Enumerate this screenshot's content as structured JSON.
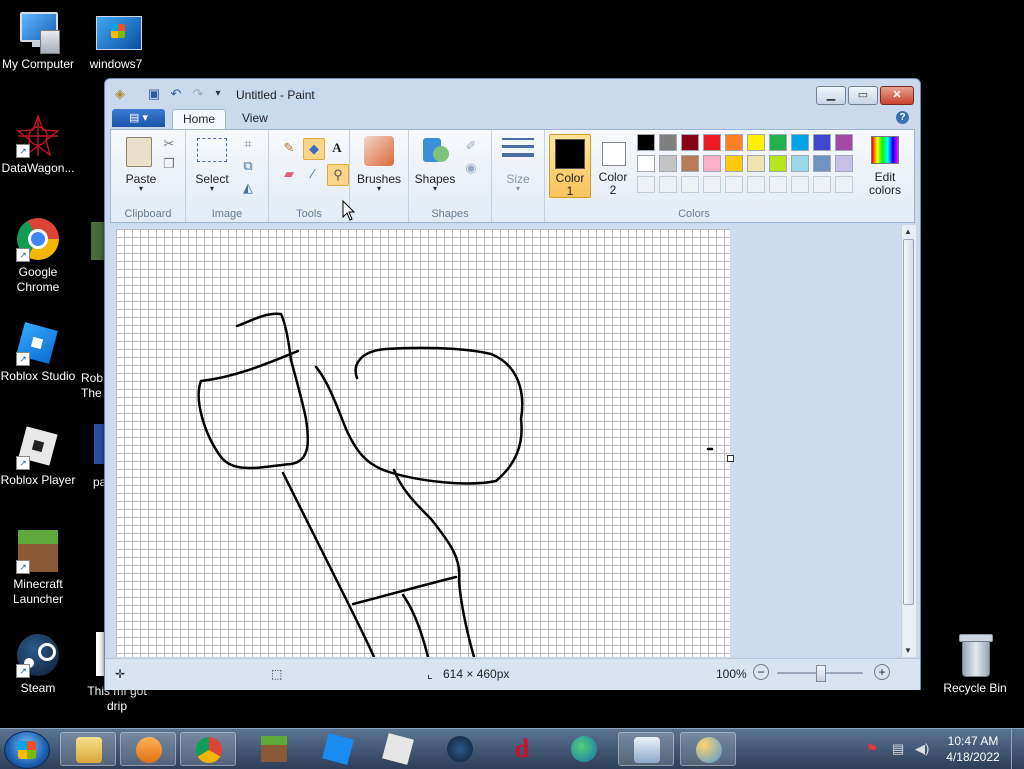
{
  "desktop": {
    "icons": [
      {
        "label": "My Computer"
      },
      {
        "label": "windows7"
      },
      {
        "label": "DataWagon..."
      },
      {
        "label": "Google Chrome"
      },
      {
        "label": "Roblox Studio"
      },
      {
        "label": "Roblox Player"
      },
      {
        "label": "Minecraft Launcher"
      },
      {
        "label": "Steam"
      },
      {
        "label": "This mf got drip"
      },
      {
        "label": "Recycle Bin"
      }
    ],
    "partial_labels": [
      "Rob",
      "The",
      "pa"
    ]
  },
  "window": {
    "title": "Untitled - Paint",
    "tabs": [
      "Home",
      "View"
    ],
    "help": "?",
    "ribbon": {
      "clipboard": {
        "group": "Clipboard",
        "paste": "Paste"
      },
      "image": {
        "group": "Image",
        "select": "Select"
      },
      "tools": {
        "group": "Tools"
      },
      "brushes": {
        "label": "Brushes"
      },
      "shapes": {
        "group": "Shapes",
        "label": "Shapes"
      },
      "size": {
        "label": "Size"
      },
      "colors": {
        "group": "Colors",
        "color1": "Color",
        "color1_num": "1",
        "color2": "Color",
        "color2_num": "2",
        "edit1": "Edit",
        "edit2": "colors",
        "color1_value": "#000000",
        "color2_value": "#ffffff",
        "palette_row1": [
          "#000000",
          "#7f7f7f",
          "#880015",
          "#ed1c24",
          "#ff7f27",
          "#fff200",
          "#22b14c",
          "#00a2e8",
          "#3f48cc",
          "#a349a4"
        ],
        "palette_row2": [
          "#ffffff",
          "#c3c3c3",
          "#b97a57",
          "#ffaec9",
          "#ffc90e",
          "#efe4b0",
          "#b5e61d",
          "#99d9ea",
          "#7092be",
          "#c8bfe7"
        ]
      }
    },
    "status": {
      "dimensions": "614 × 460px",
      "zoom": "100%"
    }
  },
  "taskbar": {
    "time": "10:47 AM",
    "date": "4/18/2022"
  }
}
